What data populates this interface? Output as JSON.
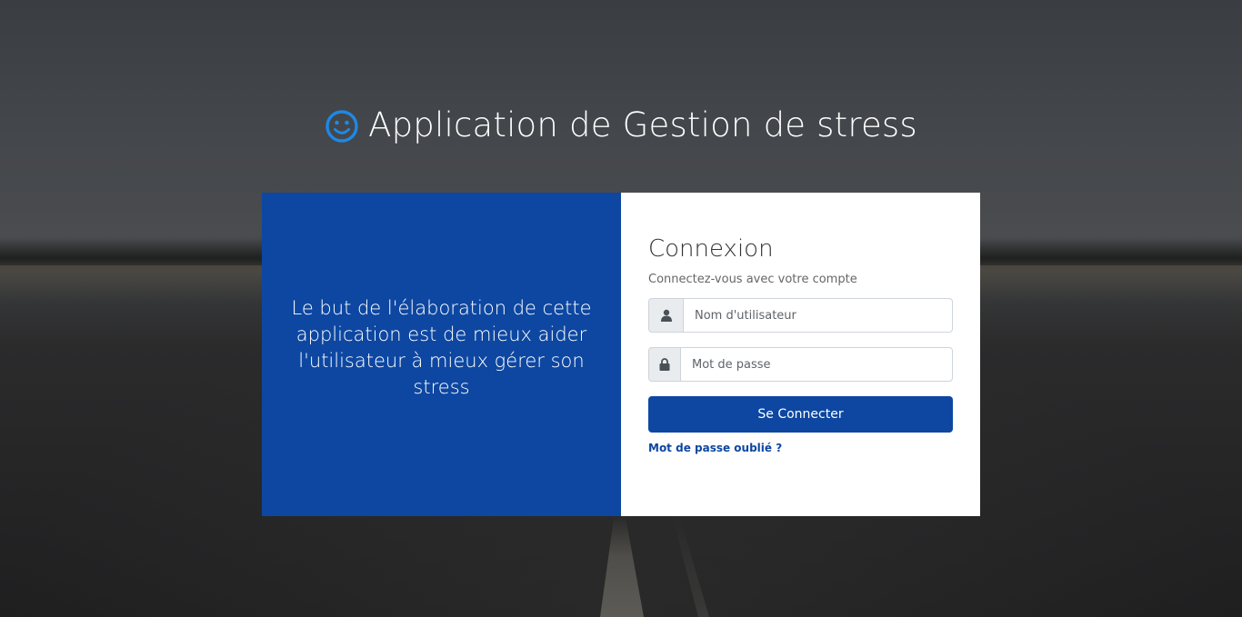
{
  "app": {
    "title": "Application de Gestion de stress",
    "title_icon": "smile-icon"
  },
  "intro": {
    "text": "Le but de l'élaboration de cette application est de mieux aider l'utilisateur à mieux gérer son stress"
  },
  "login": {
    "heading": "Connexion",
    "subheading": "Connectez-vous avec votre compte",
    "username": {
      "placeholder": "Nom d'utilisateur",
      "value": "",
      "icon": "user-icon"
    },
    "password": {
      "placeholder": "Mot de passe",
      "value": "",
      "icon": "lock-icon"
    },
    "submit_label": "Se Connecter",
    "forgot_label": "Mot de passe oublié ?"
  },
  "colors": {
    "accent": "#0d47a1",
    "icon_blue": "#1e88e5",
    "panel_bg": "#ffffff"
  }
}
